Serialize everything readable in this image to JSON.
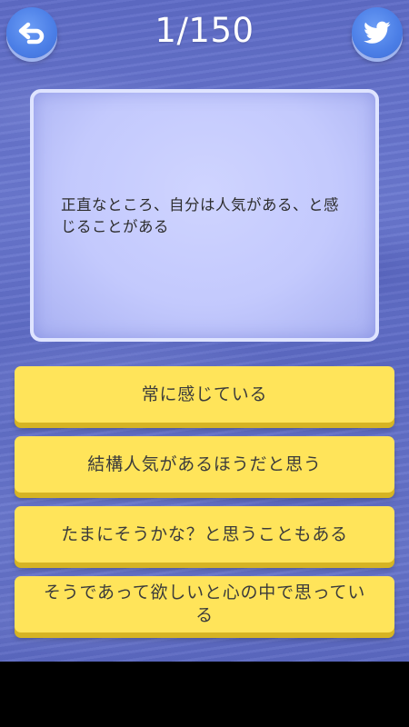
{
  "header": {
    "counter": "1/150",
    "back_icon": "undo-arrow-icon",
    "share_icon": "twitter-bird-icon"
  },
  "question": {
    "text": "正直なところ、自分は人気がある、と感じることがある"
  },
  "answers": [
    {
      "label": "常に感じている"
    },
    {
      "label": "結構人気があるほうだと思う"
    },
    {
      "label": "たまにそうかな？と思うこともある"
    },
    {
      "label": "そうであって欲しいと心の中で思っている"
    }
  ],
  "colors": {
    "background": "#6471c9",
    "answer_button": "#ffe45a",
    "icon_button": "#4b7ee6",
    "card": "#c5cafd"
  }
}
